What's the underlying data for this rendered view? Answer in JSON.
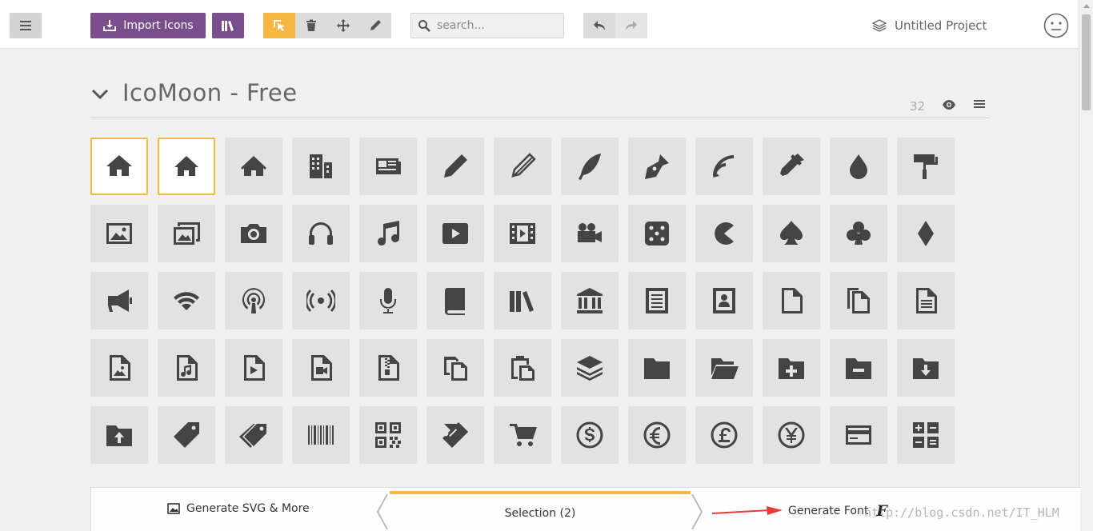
{
  "toolbar": {
    "import_label": "Import Icons",
    "search_placeholder": "search...",
    "project_name": "Untitled Project"
  },
  "icon_set": {
    "title": "IcoMoon - Free",
    "count": "32"
  },
  "icons": [
    "home",
    "home2",
    "home3",
    "office",
    "newspaper",
    "pencil",
    "pencil2",
    "quill",
    "pen",
    "blog",
    "eyedropper",
    "droplet",
    "paint-format",
    "image",
    "images",
    "camera",
    "headphones",
    "music",
    "play",
    "film",
    "video-camera",
    "dice",
    "pacman",
    "spades",
    "clubs",
    "diamonds",
    "bullhorn",
    "connection",
    "podcast",
    "feed",
    "mic",
    "book",
    "books",
    "library",
    "file-text",
    "profile",
    "file-empty",
    "files-empty",
    "file-text2",
    "file-picture",
    "file-music",
    "file-play",
    "file-video",
    "file-zip",
    "copy",
    "paste",
    "stack",
    "folder",
    "folder-open",
    "folder-plus",
    "folder-minus",
    "folder-download",
    "folder-upload",
    "price-tag",
    "price-tags",
    "barcode",
    "qrcode",
    "ticket",
    "cart",
    "coin-dollar",
    "coin-euro",
    "coin-pound",
    "coin-yen",
    "credit-card",
    "calculator"
  ],
  "selected_icons": [
    "home",
    "home2"
  ],
  "bottom": {
    "generate_svg_label": "Generate SVG & More",
    "selection_label": "Selection (2)",
    "generate_font_label": "Generate Font",
    "font_glyph": "F"
  },
  "watermark": "http://blog.csdn.net/IT_HLM",
  "colors": {
    "accent": "#f5b642",
    "brand": "#7a4d8c",
    "annotation_arrow": "#e83a3a"
  }
}
